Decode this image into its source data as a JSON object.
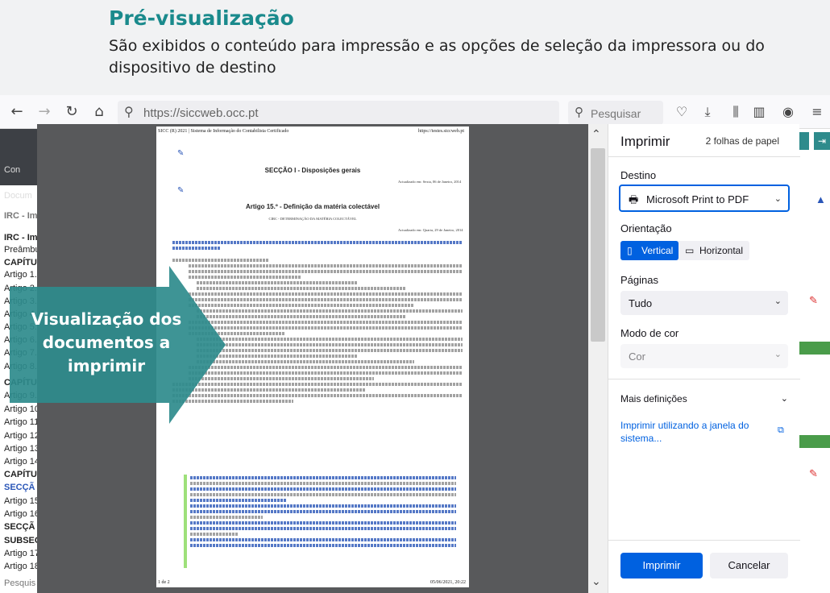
{
  "header": {
    "title": "Pré-visualização",
    "description": "São exibidos o conteúdo para impressão e as opções de seleção da impressora ou do dispositivo de destino"
  },
  "browser": {
    "url": "https://siccweb.occ.pt",
    "search_placeholder": "Pesquisar"
  },
  "background_sidebar": {
    "items": [
      "Con",
      "Docum",
      "IRC - Im",
      "IRC - Im",
      "Preâmbu",
      "CAPÍTU",
      "Artigo 1.",
      "Artigo 2.",
      "Artigo 3.",
      "Artigo 4.",
      "Artigo 5.",
      "Artigo 6.",
      "Artigo 7.",
      "Artigo 8.",
      "CAPÍTU",
      "Artigo 9.",
      "Artigo 10",
      "Artigo 11",
      "Artigo 12",
      "Artigo 13",
      "Artigo 14",
      "CAPÍTU",
      "SECÇÃ",
      "Artigo 15",
      "Artigo 16",
      "SECÇÃ",
      "SUBSEC",
      "Artigo 17",
      "Artigo 18",
      "Pesquis"
    ]
  },
  "document_page": {
    "header_left": "SICC (R) 2021 | Sistema de Informação do Contabilista Certificado",
    "header_right": "https://testes.siccweb.pt",
    "section_title": "SECÇÃO I - Disposições gerais",
    "section_date": "Actualizado em: Sexta, 06 de Janeiro, 2014",
    "article_title": "Artigo 15.º - Definição da matéria colectável",
    "article_sub": "CIRC - DETERMINAÇÃO DA MATÉRIA COLECTÁVEL",
    "article_date": "Actualizado em: Quarta, 29 de Janeiro, 2014",
    "footer_left": "1 de 2",
    "footer_right": "05/06/2021, 20:22"
  },
  "callout": {
    "text": "Visualização dos documentos a imprimir"
  },
  "print_dialog": {
    "title": "Imprimir",
    "sheets": "2 folhas de papel",
    "destination_label": "Destino",
    "destination_value": "Microsoft Print to PDF",
    "orientation_label": "Orientação",
    "orientation_vertical": "Vertical",
    "orientation_horizontal": "Horizontal",
    "pages_label": "Páginas",
    "pages_value": "Tudo",
    "color_label": "Modo de cor",
    "color_value": "Cor",
    "more_settings": "Mais definições",
    "system_dialog_link": "Imprimir utilizando a janela do sistema...",
    "print_button": "Imprimir",
    "cancel_button": "Cancelar"
  },
  "colors": {
    "accent": "#0061e0",
    "callout": "#2e8b8c",
    "title": "#1a8a8c"
  }
}
